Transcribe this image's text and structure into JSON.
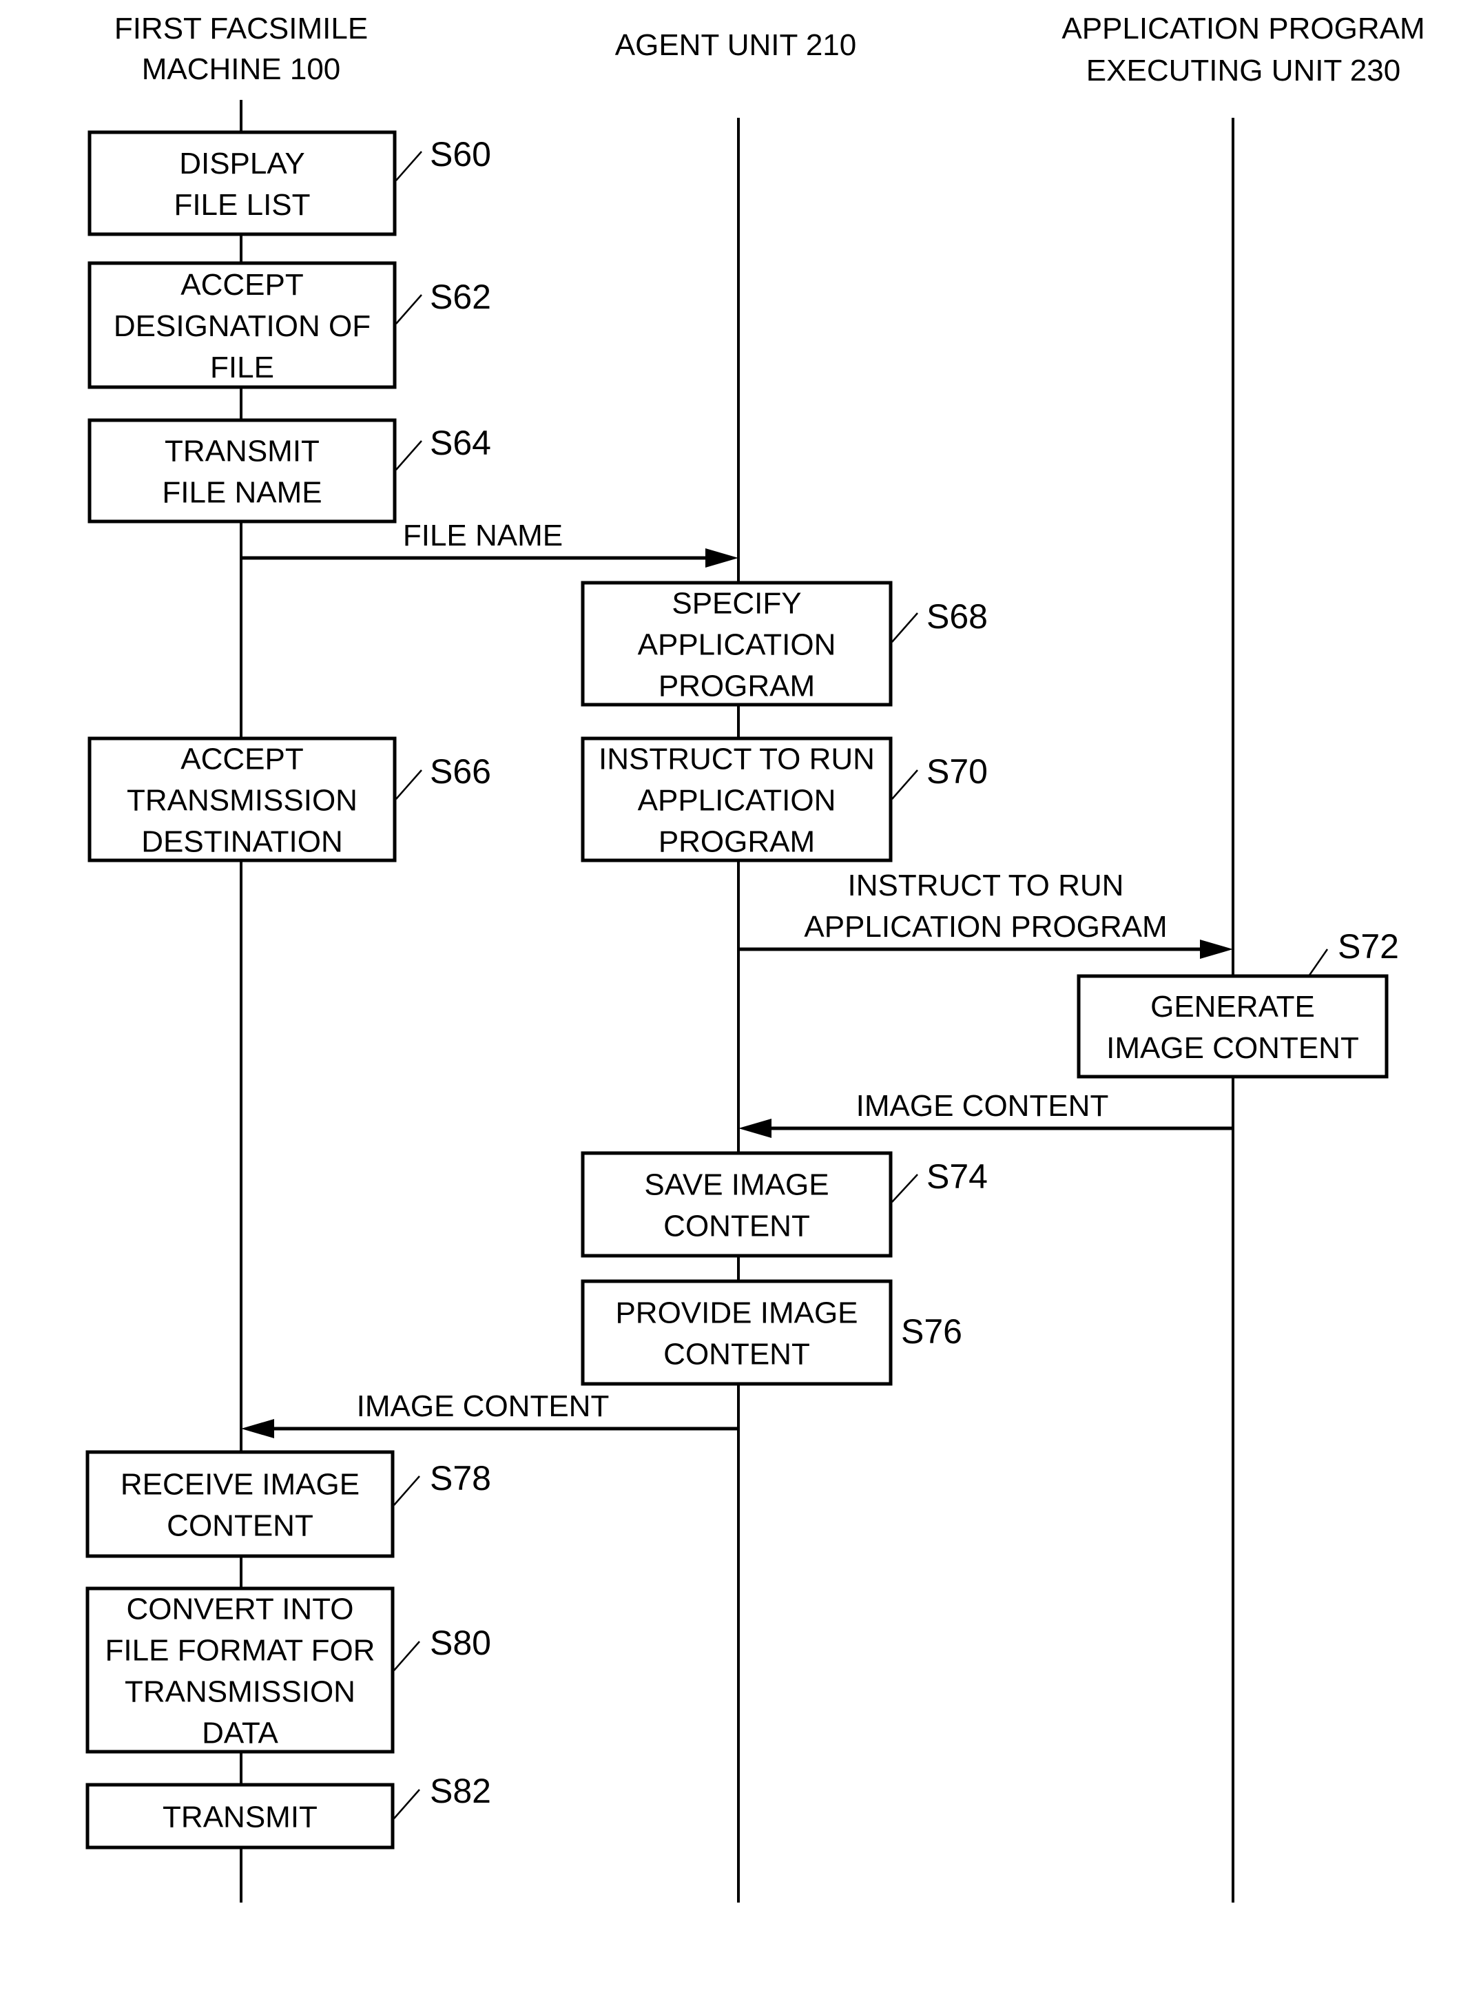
{
  "lanes": [
    {
      "id": "fax",
      "title_lines": [
        "FIRST FACSIMILE",
        "MACHINE 100"
      ]
    },
    {
      "id": "agent",
      "title_lines": [
        "AGENT UNIT 210"
      ]
    },
    {
      "id": "app",
      "title_lines": [
        "APPLICATION PROGRAM",
        "EXECUTING UNIT 230"
      ]
    }
  ],
  "steps": [
    {
      "id": "S60",
      "label": "S60",
      "lane": "fax",
      "lines": [
        "DISPLAY",
        "FILE LIST"
      ]
    },
    {
      "id": "S62",
      "label": "S62",
      "lane": "fax",
      "lines": [
        "ACCEPT",
        "DESIGNATION OF",
        "FILE"
      ]
    },
    {
      "id": "S64",
      "label": "S64",
      "lane": "fax",
      "lines": [
        "TRANSMIT",
        "FILE NAME"
      ]
    },
    {
      "id": "S68",
      "label": "S68",
      "lane": "agent",
      "lines": [
        "SPECIFY",
        "APPLICATION",
        "PROGRAM"
      ]
    },
    {
      "id": "S66",
      "label": "S66",
      "lane": "fax",
      "lines": [
        "ACCEPT",
        "TRANSMISSION",
        "DESTINATION"
      ]
    },
    {
      "id": "S70",
      "label": "S70",
      "lane": "agent",
      "lines": [
        "INSTRUCT TO RUN",
        "APPLICATION",
        "PROGRAM"
      ]
    },
    {
      "id": "S72",
      "label": "S72",
      "lane": "app",
      "lines": [
        "GENERATE",
        "IMAGE CONTENT"
      ]
    },
    {
      "id": "S74",
      "label": "S74",
      "lane": "agent",
      "lines": [
        "SAVE IMAGE",
        "CONTENT"
      ]
    },
    {
      "id": "S76",
      "label": "S76",
      "lane": "agent",
      "lines": [
        "PROVIDE IMAGE",
        "CONTENT"
      ]
    },
    {
      "id": "S78",
      "label": "S78",
      "lane": "fax",
      "lines": [
        "RECEIVE IMAGE",
        "CONTENT"
      ]
    },
    {
      "id": "S80",
      "label": "S80",
      "lane": "fax",
      "lines": [
        "CONVERT INTO",
        "FILE FORMAT FOR",
        "TRANSMISSION",
        "DATA"
      ]
    },
    {
      "id": "S82",
      "label": "S82",
      "lane": "fax",
      "lines": [
        "TRANSMIT"
      ]
    }
  ],
  "messages": [
    {
      "id": "m1",
      "from": "fax",
      "to": "agent",
      "lines": [
        "FILE NAME"
      ]
    },
    {
      "id": "m2",
      "from": "agent",
      "to": "app",
      "lines": [
        "INSTRUCT TO RUN",
        "APPLICATION PROGRAM"
      ]
    },
    {
      "id": "m3",
      "from": "app",
      "to": "agent",
      "lines": [
        "IMAGE CONTENT"
      ]
    },
    {
      "id": "m4",
      "from": "agent",
      "to": "fax",
      "lines": [
        "IMAGE CONTENT"
      ]
    }
  ]
}
